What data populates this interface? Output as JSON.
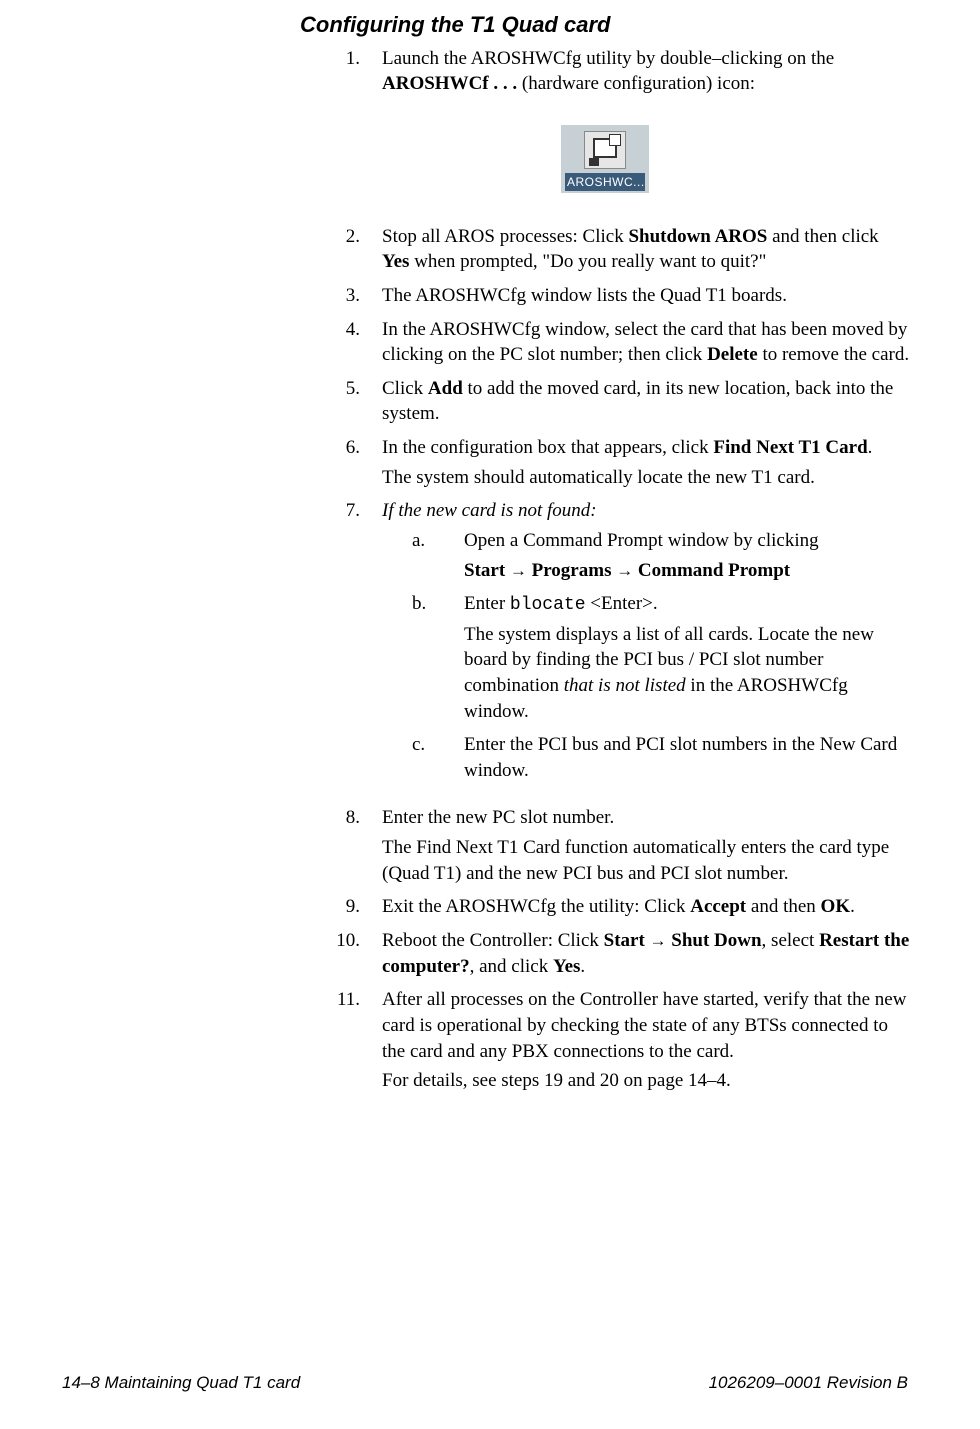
{
  "section_title": "Configuring the T1 Quad card",
  "steps": {
    "s1": {
      "num": "1.",
      "text_a": "Launch the AROSHWCfg utility by double–clicking on the ",
      "text_b": "AROSHWCf . . .",
      "text_c": " (hardware configuration) icon:"
    },
    "icon_label": "AROSHWC...",
    "s2": {
      "num": "2.",
      "a": "Stop all AROS processes: Click ",
      "b": "Shutdown AROS",
      "c": " and then click ",
      "d": "Yes",
      "e": " when prompted, \"Do you really want to quit?\""
    },
    "s3": {
      "num": "3.",
      "text": "The AROSHWCfg window lists the Quad T1 boards."
    },
    "s4": {
      "num": "4.",
      "a": "In the AROSHWCfg window, select the card that has been moved by clicking on the PC slot number; then click ",
      "b": "Delete",
      "c": " to remove the card."
    },
    "s5": {
      "num": "5.",
      "a": "Click ",
      "b": "Add",
      "c": " to add the moved card, in its new location, back into the system."
    },
    "s6": {
      "num": "6.",
      "a": "In the configuration box that appears, click ",
      "b": "Find Next T1 Card",
      "c": ".",
      "cont": "The system should automatically locate the new T1 card."
    },
    "s7": {
      "num": "7.",
      "lead": "If the new card is not found:",
      "a": {
        "label": "a.",
        "l1": "Open a Command Prompt window by clicking",
        "m1": "Start",
        "arr": " → ",
        "m2": "Programs",
        "m3": "Command Prompt"
      },
      "b": {
        "label": "b.",
        "l1a": "Enter ",
        "l1b": "blocate",
        "l1c": " <Enter>.",
        "cont_a": "The system displays a list of all cards. Locate the new board by finding the PCI bus / PCI slot number combination ",
        "cont_b": "that is not listed",
        "cont_c": " in the AROSHWCfg window."
      },
      "c": {
        "label": "c.",
        "text": "Enter the PCI bus and PCI slot numbers in the New Card window."
      }
    },
    "s8": {
      "num": "8.",
      "l1": "Enter the new PC slot number.",
      "cont": "The Find Next T1 Card function automatically enters the card type (Quad T1) and the new PCI bus and PCI slot number."
    },
    "s9": {
      "num": "9.",
      "a": "Exit the AROSHWCfg the utility: Click ",
      "b": "Accept",
      "c": " and then ",
      "d": "OK",
      "e": "."
    },
    "s10": {
      "num": "10.",
      "a": "Reboot the Controller: Click ",
      "b": "Start",
      "arr": " → ",
      "c": "Shut Down",
      "d": ", select ",
      "e": "Restart the computer?",
      "f": ", and click ",
      "g": "Yes",
      "h": "."
    },
    "s11": {
      "num": "11.",
      "l1": "After all processes on the Controller have started, verify that the new card is operational by checking the state of any BTSs connected to the card and any PBX connections to the card.",
      "cont": "For details, see steps 19 and 20 on page 14–4."
    }
  },
  "footer": {
    "left": "14–8  Maintaining Quad T1 card",
    "right": "1026209–0001  Revision B"
  }
}
